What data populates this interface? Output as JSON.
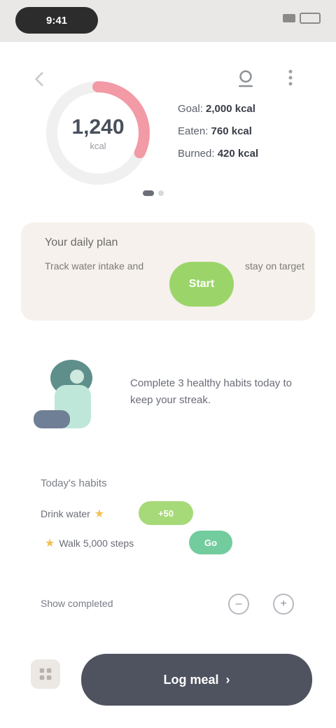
{
  "status": {
    "time": "9:41"
  },
  "ring": {
    "value": "1,240",
    "unit": "kcal",
    "progress_fraction": 0.32,
    "track_color": "#f0f0f0",
    "progress_color": "#f29aa6"
  },
  "stats": [
    {
      "label": "Goal",
      "value": "2,000 kcal"
    },
    {
      "label": "Eaten",
      "value": "760 kcal"
    },
    {
      "label": "Burned",
      "value": "420 kcal"
    }
  ],
  "pager": {
    "count": 2,
    "active_index": 0
  },
  "banner": {
    "title": "Your daily plan",
    "subtitle": "Track water intake and",
    "cta": "Start",
    "right_text": "stay on target"
  },
  "info": {
    "text": "Complete 3 healthy habits today to keep your streak."
  },
  "habits": {
    "title": "Today's habits",
    "items": [
      {
        "label": "Drink water",
        "stars": "★",
        "pill": "+50",
        "pill_color": "#a6d978"
      },
      {
        "label": "Walk 5,000 steps",
        "stars": "★",
        "pill": "Go",
        "pill_color": "#73cc9e"
      }
    ]
  },
  "footer": {
    "label": "Show completed",
    "minus": "–",
    "plus": "+"
  },
  "bottom": {
    "primary": "Log meal",
    "primary_icon": "›"
  }
}
